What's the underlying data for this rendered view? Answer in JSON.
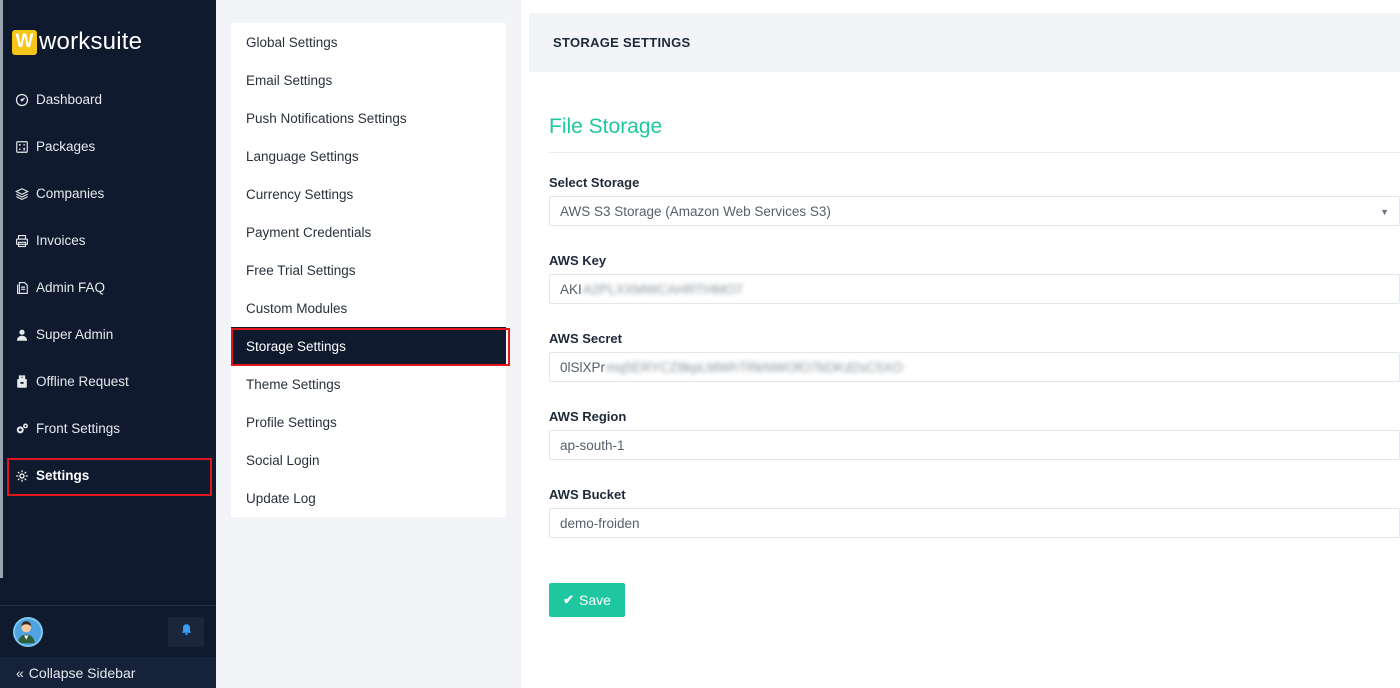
{
  "brand": {
    "mark": "W",
    "name": "worksuite"
  },
  "sidebar": {
    "items": [
      {
        "label": "Dashboard",
        "icon": "dashboard-gauge-icon"
      },
      {
        "label": "Packages",
        "icon": "packages-icon"
      },
      {
        "label": "Companies",
        "icon": "layers-icon"
      },
      {
        "label": "Invoices",
        "icon": "printer-icon"
      },
      {
        "label": "Admin FAQ",
        "icon": "document-icon"
      },
      {
        "label": "Super Admin",
        "icon": "user-icon"
      },
      {
        "label": "Offline Request",
        "icon": "briefcase-icon"
      },
      {
        "label": "Front Settings",
        "icon": "cogs-icon"
      },
      {
        "label": "Settings",
        "icon": "gear-icon",
        "active": true
      }
    ],
    "collapse_label": "Collapse Sidebar"
  },
  "settings_menu": {
    "items": [
      "Global Settings",
      "Email Settings",
      "Push Notifications Settings",
      "Language Settings",
      "Currency Settings",
      "Payment Credentials",
      "Free Trial Settings",
      "Custom Modules",
      "Storage Settings",
      "Theme Settings",
      "Profile Settings",
      "Social Login",
      "Update Log"
    ],
    "active": "Storage Settings"
  },
  "main": {
    "header": "STORAGE SETTINGS",
    "section_title": "File Storage",
    "fields": {
      "storage": {
        "label": "Select Storage",
        "value": "AWS S3 Storage (Amazon Web Services S3)"
      },
      "key": {
        "label": "AWS Key",
        "value_visible": "AKI",
        "value_masked": "A2PLXXMWCAHRTHMO7"
      },
      "secret": {
        "label": "AWS Secret",
        "value_visible": "0lSlXPr",
        "value_masked": "mq5ERYCZ8kpLMWhTRkNWOfO7bDKd2sC5XO"
      },
      "region": {
        "label": "AWS Region",
        "value": "ap-south-1"
      },
      "bucket": {
        "label": "AWS Bucket",
        "value": "demo-froiden"
      }
    },
    "save_label": "Save"
  },
  "colors": {
    "sidebar_bg": "#0f1a2f",
    "accent": "#1fc7a0",
    "highlight_border": "#e1161d",
    "brand_yellow": "#f5c518"
  }
}
